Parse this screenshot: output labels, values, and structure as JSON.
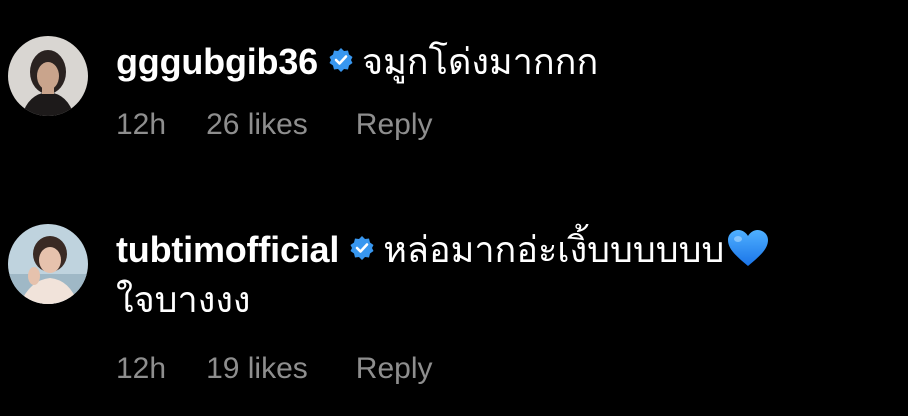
{
  "comments": [
    {
      "username": "gggubgib36",
      "verified": true,
      "text": "จมูกโด่งมากกก",
      "time": "12h",
      "likes": "26 likes",
      "reply_label": "Reply"
    },
    {
      "username": "tubtimofficial",
      "verified": true,
      "text": "หล่อมากอ่ะเงิ้บบบบบบ",
      "emoji": "blue-heart-icon",
      "text_line2": "ใจบางงง",
      "time": "12h",
      "likes": "19 likes",
      "reply_label": "Reply"
    }
  ],
  "colors": {
    "background": "#000000",
    "primary_text": "#ffffff",
    "secondary_text": "#8e8e8e",
    "verified_badge": "#3897f0",
    "heart": "#1e90ff"
  }
}
